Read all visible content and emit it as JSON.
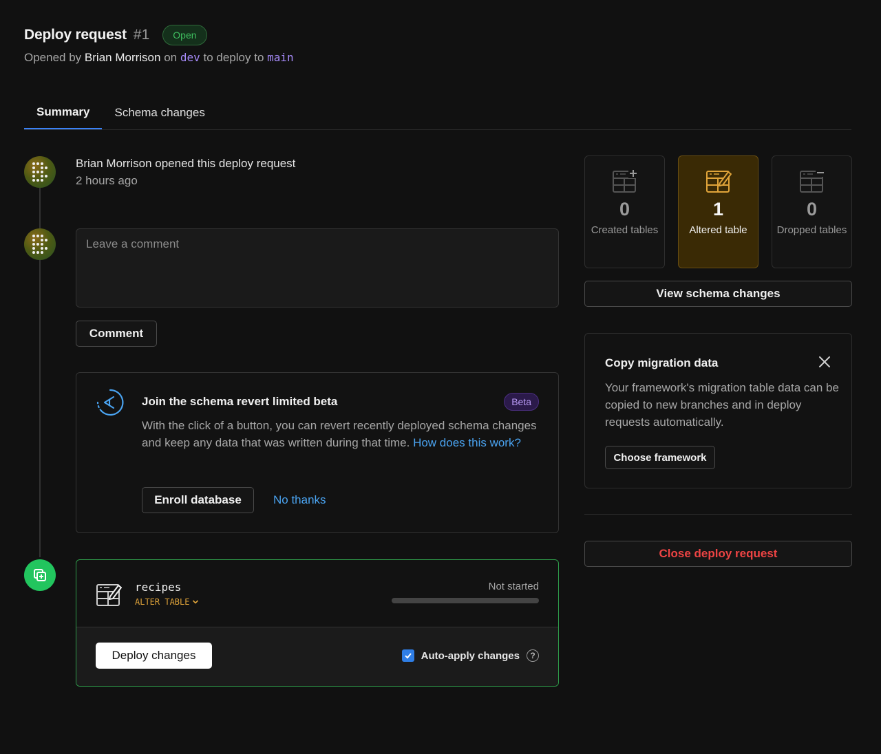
{
  "header": {
    "title": "Deploy request",
    "number": "#1",
    "status": "Open",
    "opened_by_prefix": "Opened by",
    "user": "Brian Morrison",
    "on": "on",
    "from_branch": "dev",
    "to_text": "to deploy to",
    "to_branch": "main"
  },
  "tabs": [
    {
      "label": "Summary",
      "active": true
    },
    {
      "label": "Schema changes",
      "active": false
    }
  ],
  "timeline": {
    "event_text": "Brian Morrison opened this deploy request",
    "event_time": "2 hours ago",
    "comment_placeholder": "Leave a comment",
    "comment_button": "Comment"
  },
  "beta": {
    "title": "Join the schema revert limited beta",
    "badge": "Beta",
    "text": "With the click of a button, you can revert recently deployed schema changes and keep any data that was written during that time.",
    "link": "How does this work?",
    "enroll_button": "Enroll database",
    "no_thanks": "No thanks"
  },
  "deploy": {
    "table_name": "recipes",
    "operation": "ALTER TABLE",
    "status": "Not started",
    "progress": 0,
    "deploy_button": "Deploy changes",
    "auto_apply_label": "Auto-apply changes",
    "auto_apply_checked": true,
    "help": "?"
  },
  "stats": [
    {
      "value": "0",
      "label": "Created tables",
      "highlighted": false,
      "icon": "table-add-icon"
    },
    {
      "value": "1",
      "label": "Altered table",
      "highlighted": true,
      "icon": "table-edit-icon"
    },
    {
      "value": "0",
      "label": "Dropped tables",
      "highlighted": false,
      "icon": "table-remove-icon"
    }
  ],
  "view_schema_button": "View schema changes",
  "migration": {
    "title": "Copy migration data",
    "text": "Your framework's migration table data can be copied to new branches and in deploy requests automatically.",
    "button": "Choose framework"
  },
  "close_request_button": "Close deploy request",
  "colors": {
    "accent_blue": "#3b82f6",
    "success_green": "#22c55e",
    "altered_amber": "#e0a43a",
    "danger_red": "#ef4444",
    "beta_purple": "#b99af5"
  }
}
